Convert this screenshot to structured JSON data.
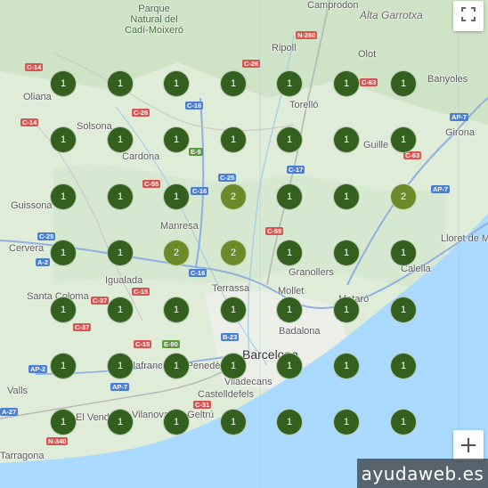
{
  "map": {
    "places": [
      {
        "name": "Camprodon",
        "class": "",
        "pos": "camprodon"
      },
      {
        "name": "Alta Garrotxa",
        "class": "region",
        "pos": "alta"
      },
      {
        "name": "Parque\nNatural del\nCadí-Moixeró",
        "class": "park",
        "pos": "parque"
      },
      {
        "name": "Ripoll",
        "class": "",
        "pos": "ripoll"
      },
      {
        "name": "Olot",
        "class": "",
        "pos": "olot"
      },
      {
        "name": "Banyoles",
        "class": "",
        "pos": "banyoles"
      },
      {
        "name": "Oliana",
        "class": "",
        "pos": "oliana"
      },
      {
        "name": "Solsona",
        "class": "",
        "pos": "solsona"
      },
      {
        "name": "Torelló",
        "class": "",
        "pos": "torello"
      },
      {
        "name": "Girona",
        "class": "",
        "pos": "girona"
      },
      {
        "name": "Cardona",
        "class": "",
        "pos": "cardona"
      },
      {
        "name": "Guille",
        "class": "",
        "pos": "guille"
      },
      {
        "name": "Guissona",
        "class": "",
        "pos": "guissona"
      },
      {
        "name": "Manresa",
        "class": "",
        "pos": "manresa"
      },
      {
        "name": "Cervera",
        "class": "",
        "pos": "cervera"
      },
      {
        "name": "Lloret de Mar",
        "class": "",
        "pos": "lloret"
      },
      {
        "name": "Granollers",
        "class": "",
        "pos": "granollers"
      },
      {
        "name": "Calella",
        "class": "",
        "pos": "calella"
      },
      {
        "name": "Igualada",
        "class": "",
        "pos": "igualada"
      },
      {
        "name": "Terrassa",
        "class": "",
        "pos": "terrassa"
      },
      {
        "name": "Santa Coloma",
        "class": "",
        "pos": "santacoloma"
      },
      {
        "name": "Mollet",
        "class": "",
        "pos": "mollet"
      },
      {
        "name": "Mataró",
        "class": "",
        "pos": "mataro"
      },
      {
        "name": "Badalona",
        "class": "",
        "pos": "badalona"
      },
      {
        "name": "Barcelona",
        "class": "big",
        "pos": "barcelona"
      },
      {
        "name": "Vilafranca del Penedès",
        "class": "",
        "pos": "vilafranca"
      },
      {
        "name": "Viladecans",
        "class": "",
        "pos": "viladecans"
      },
      {
        "name": "Castelldefels",
        "class": "",
        "pos": "castelldefels"
      },
      {
        "name": "Valls",
        "class": "",
        "pos": "valls"
      },
      {
        "name": "El Vendrell",
        "class": "",
        "pos": "elvendrell"
      },
      {
        "name": "Vilanova i la Geltrú",
        "class": "",
        "pos": "vilanova"
      },
      {
        "name": "Tarragona",
        "class": "",
        "pos": "tarragona"
      }
    ],
    "road_shields": [
      {
        "label": "N-260",
        "color": "red",
        "pos": "n260"
      },
      {
        "label": "C-14",
        "color": "red",
        "pos": "c14a"
      },
      {
        "label": "C-26",
        "color": "red",
        "pos": "c26"
      },
      {
        "label": "C-63",
        "color": "red",
        "pos": "c63a"
      },
      {
        "label": "C-14",
        "color": "red",
        "pos": "c14b"
      },
      {
        "label": "C-26",
        "color": "red",
        "pos": "c26b"
      },
      {
        "label": "C-16",
        "color": "blue",
        "pos": "c16a"
      },
      {
        "label": "AP-7",
        "color": "blue",
        "pos": "ap7a"
      },
      {
        "label": "E-9",
        "color": "green",
        "pos": "e9"
      },
      {
        "label": "C-63",
        "color": "red",
        "pos": "c63b"
      },
      {
        "label": "C-25",
        "color": "blue",
        "pos": "c25a"
      },
      {
        "label": "C-17",
        "color": "blue",
        "pos": "c17"
      },
      {
        "label": "C-55",
        "color": "red",
        "pos": "c55"
      },
      {
        "label": "C-16",
        "color": "blue",
        "pos": "c16b"
      },
      {
        "label": "AP-7",
        "color": "blue",
        "pos": "ap7b"
      },
      {
        "label": "C-25",
        "color": "blue",
        "pos": "c25b"
      },
      {
        "label": "C-59",
        "color": "red",
        "pos": "c59"
      },
      {
        "label": "A-2",
        "color": "blue",
        "pos": "a2a"
      },
      {
        "label": "C-16",
        "color": "blue",
        "pos": "c16c"
      },
      {
        "label": "C-15",
        "color": "red",
        "pos": "c15a"
      },
      {
        "label": "C-37",
        "color": "red",
        "pos": "c37a"
      },
      {
        "label": "C-37",
        "color": "red",
        "pos": "c37b"
      },
      {
        "label": "C-15",
        "color": "red",
        "pos": "c15b"
      },
      {
        "label": "E-90",
        "color": "green",
        "pos": "e90"
      },
      {
        "label": "B-23",
        "color": "blue",
        "pos": "b23"
      },
      {
        "label": "AP-2",
        "color": "blue",
        "pos": "ap2"
      },
      {
        "label": "AP-7",
        "color": "blue",
        "pos": "ap7c"
      },
      {
        "label": "A-27",
        "color": "blue",
        "pos": "a27"
      },
      {
        "label": "C-31",
        "color": "red",
        "pos": "c31"
      },
      {
        "label": "N-340",
        "color": "red",
        "pos": "n340"
      }
    ],
    "cluster_markers": [
      [
        "1",
        "1",
        "1",
        "1",
        "1",
        "1",
        "1"
      ],
      [
        "1",
        "1",
        "1",
        "1",
        "1",
        "1",
        "1"
      ],
      [
        "1",
        "1",
        "1",
        "2",
        "1",
        "1",
        "2"
      ],
      [
        "1",
        "1",
        "2",
        "2",
        "1",
        "1",
        "1"
      ],
      [
        "1",
        "1",
        "1",
        "1",
        "1",
        "1",
        "1"
      ],
      [
        "1",
        "1",
        "1",
        "1",
        "1",
        "1",
        "1"
      ],
      [
        "1",
        "1",
        "1",
        "1",
        "1",
        "1",
        "1"
      ]
    ],
    "marker_colors": {
      "single": "#33601f",
      "multi": "#6b8a2a"
    }
  },
  "controls": {
    "fullscreen_icon": "fullscreen-icon",
    "zoom_in_label": "+"
  },
  "watermark": {
    "text": "ayudaweb.es"
  }
}
